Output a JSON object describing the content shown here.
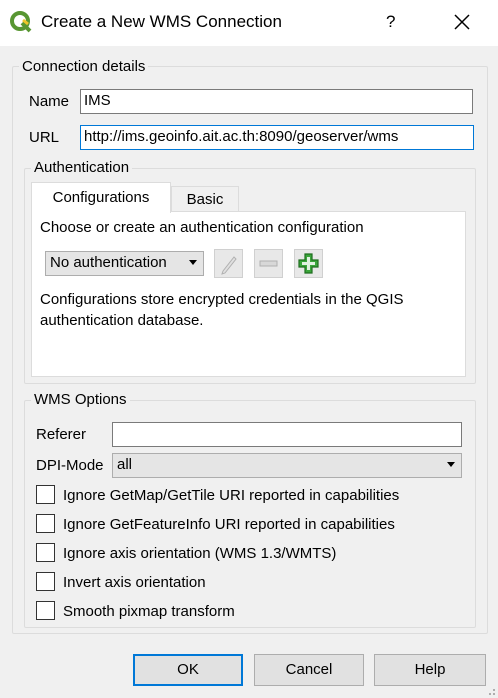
{
  "window": {
    "title": "Create a New WMS Connection",
    "help_glyph": "?",
    "close_icon": "close-icon",
    "app_icon": "qgis-logo-icon"
  },
  "connection": {
    "group_label": "Connection details",
    "name_label": "Name",
    "name_value": "IMS",
    "url_label": "URL",
    "url_value": "http://ims.geoinfo.ait.ac.th:8090/geoserver/wms"
  },
  "authentication": {
    "group_label": "Authentication",
    "tabs": [
      {
        "label": "Configurations",
        "active": true
      },
      {
        "label": "Basic",
        "active": false
      }
    ],
    "choose_text": "Choose or create an authentication configuration",
    "selected": "No authentication",
    "desc_line1": "Configurations store encrypted credentials in the QGIS",
    "desc_line2": "authentication database.",
    "icons": [
      "edit-pencil-icon",
      "remove-minus-icon",
      "add-plus-icon"
    ]
  },
  "wms_options": {
    "group_label": "WMS Options",
    "referer_label": "Referer",
    "referer_value": "",
    "dpi_label": "DPI-Mode",
    "dpi_value": "all",
    "checkboxes": [
      {
        "label": "Ignore GetMap/GetTile URI reported in capabilities",
        "checked": false
      },
      {
        "label": "Ignore GetFeatureInfo URI reported in capabilities",
        "checked": false
      },
      {
        "label": "Ignore axis orientation (WMS 1.3/WMTS)",
        "checked": false
      },
      {
        "label": "Invert axis orientation",
        "checked": false
      },
      {
        "label": "Smooth pixmap transform",
        "checked": false
      }
    ]
  },
  "buttons": {
    "ok": "OK",
    "cancel": "Cancel",
    "help": "Help"
  },
  "colors": {
    "accent": "#0078d7",
    "plus_green": "#3aa53a"
  }
}
